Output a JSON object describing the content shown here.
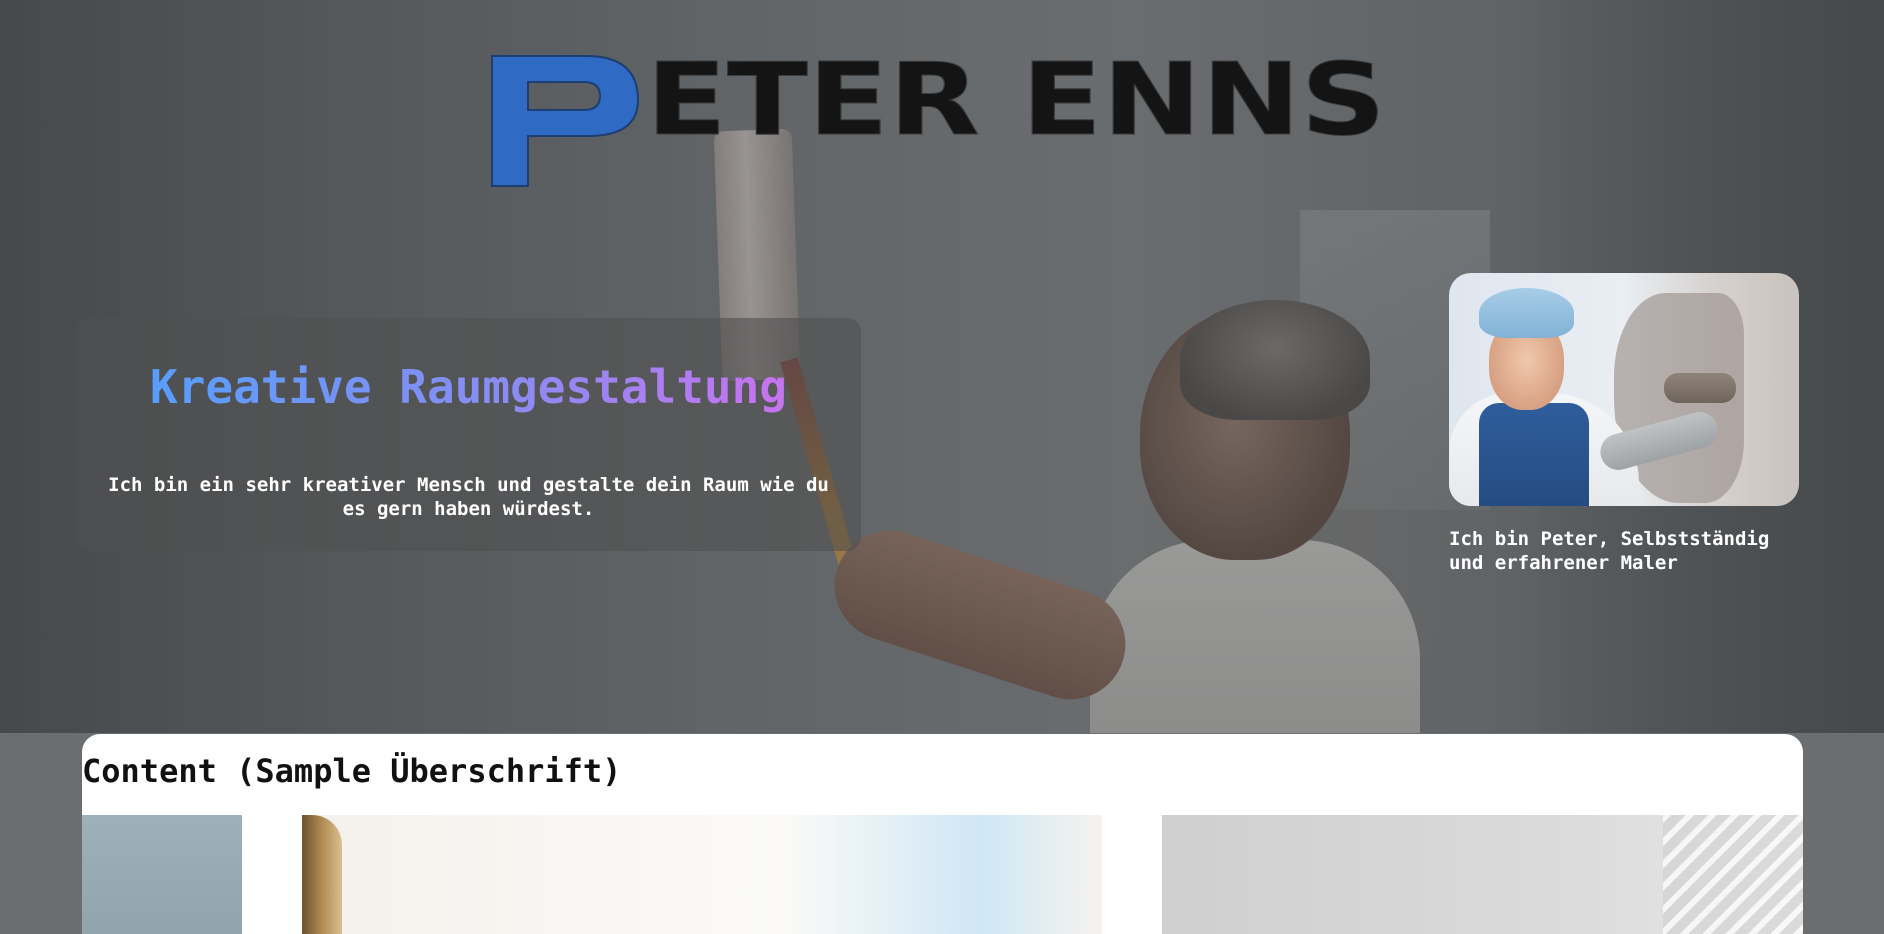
{
  "logo": {
    "text": "PETER ENNS",
    "initial": "P",
    "rest": "ETER ENNS",
    "colors": {
      "initial": "#2f6bc4",
      "rest": "#141414"
    }
  },
  "hero": {
    "title": "Kreative Raumgestaltung",
    "text": "Ich bin ein sehr kreativer Mensch und gestalte dein Raum wie du es gern haben würdest.",
    "title_gradient": [
      "#4ea1ff",
      "#8a8cf2",
      "#d86cf0"
    ]
  },
  "profile": {
    "caption": "Ich bin Peter, Selbstständig und erfahrener Maler"
  },
  "content": {
    "heading": "Content (Sample Überschrift)"
  }
}
